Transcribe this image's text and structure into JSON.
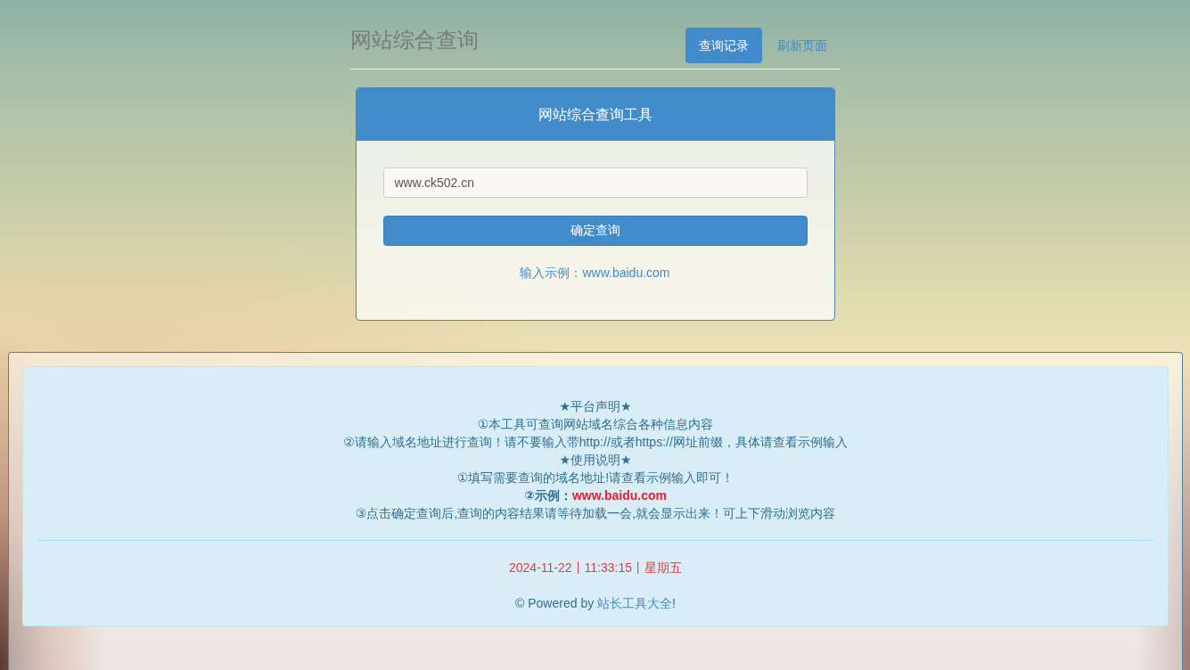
{
  "header": {
    "title": "网站综合查询",
    "nav": [
      {
        "label": "查询记录",
        "selected": true
      },
      {
        "label": "刷新页面",
        "selected": false
      }
    ]
  },
  "query_panel": {
    "title": "网站综合查询工具",
    "input": {
      "value": "www.ck502.cn"
    },
    "submit_button": "确定查询",
    "hint": "输入示例：www.baidu.com"
  },
  "notice": {
    "lines": [
      {
        "kind": "text",
        "text": "★平台声明★"
      },
      {
        "kind": "text",
        "text": "①本工具可查询网站域名综合各种信息内容"
      },
      {
        "kind": "text",
        "text": "②请输入域名地址进行查询！请不要输入带http://或者https://网址前缀，具体请查看示例输入"
      },
      {
        "kind": "text",
        "text": "★使用说明★"
      },
      {
        "kind": "text",
        "text": "①填写需要查询的域名地址!请查看示例输入即可！"
      },
      {
        "kind": "example",
        "label": "②示例：",
        "url": "www.baidu.com"
      },
      {
        "kind": "text",
        "text": "③点击确定查询后,查询的内容结果请等待加载一会,就会显示出来！可上下滑动浏览内容"
      }
    ],
    "datetime": "2024-11-22丨11:33:15丨星期五",
    "powered_by": {
      "prefix": "© Powered by ",
      "link": "站长工具大全",
      "suffix": "!"
    }
  }
}
